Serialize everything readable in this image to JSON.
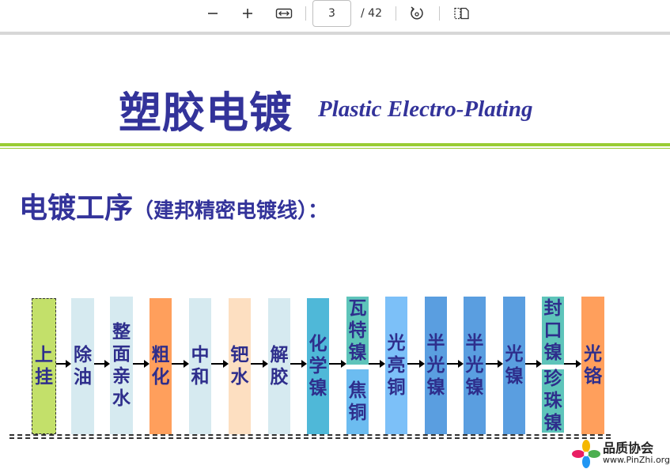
{
  "toolbar": {
    "page_current": "3",
    "page_total": "/ 42",
    "icons": [
      "zoom-out-icon",
      "zoom-in-icon",
      "fit-width-icon",
      "rotate-icon",
      "page-view-icon"
    ]
  },
  "slide": {
    "title_cn": "塑胶电镀",
    "title_en": "Plastic Electro-Plating",
    "heading_main": "电镀工序",
    "heading_sub": "（建邦精密电镀线）：",
    "colors": {
      "title": "#33339a",
      "rule": "#99cc33",
      "block_text": "#2e2e8c"
    },
    "process_steps": [
      {
        "label": "上挂",
        "color": "#c3e06a"
      },
      {
        "label": "除油",
        "color": "#d6eaf0"
      },
      {
        "label": "整面亲水",
        "color": "#d6eaf0"
      },
      {
        "label": "粗化",
        "color": "#ff9f5c"
      },
      {
        "label": "中和",
        "color": "#d6eaf0"
      },
      {
        "label": "钯水",
        "color": "#fddfc1"
      },
      {
        "label": "解胶",
        "color": "#d6eaf0"
      },
      {
        "label": "化学镍",
        "color": "#4fb8d8"
      },
      {
        "label": "瓦特镍",
        "color": "#5ec4ba"
      },
      {
        "label": "焦铜",
        "color": "#6cbcf0"
      },
      {
        "label": "光亮铜",
        "color": "#7cc0f8"
      },
      {
        "label": "半光镍",
        "color": "#5a9ee0"
      },
      {
        "label": "半光镍",
        "color": "#5a9ee0"
      },
      {
        "label": "光镍",
        "color": "#5a9ee0"
      },
      {
        "label": "封口镍",
        "color": "#5ec4ba"
      },
      {
        "label": "珍珠镍",
        "color": "#5ec4ba"
      },
      {
        "label": "光铬",
        "color": "#ff9f5c"
      }
    ]
  },
  "watermark": {
    "name": "品质协会",
    "url": "www.PinZhi.org"
  }
}
